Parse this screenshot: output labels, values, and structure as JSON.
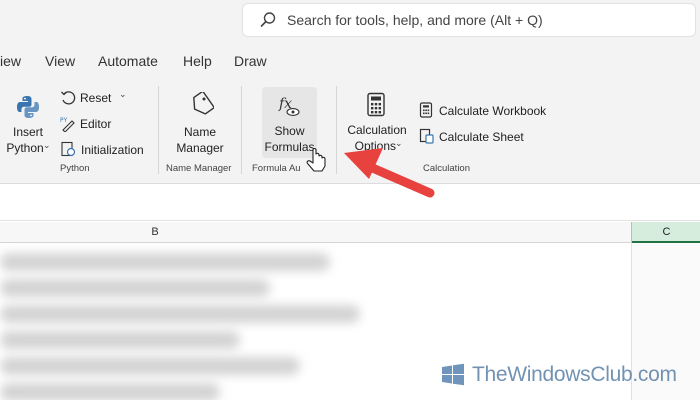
{
  "search": {
    "placeholder": "Search for tools, help, and more (Alt + Q)"
  },
  "tabs": [
    "iew",
    "View",
    "Automate",
    "Help",
    "Draw"
  ],
  "python": {
    "insert_label": "Insert",
    "python_label": "Python",
    "reset_label": "Reset",
    "editor_label": "Editor",
    "initialization_label": "Initialization",
    "group_label": "Python"
  },
  "name_manager": {
    "line1": "Name",
    "line2": "Manager",
    "group_label": "Name Manager"
  },
  "formula_auditing": {
    "line1": "Show",
    "line2": "Formulas",
    "group_label": "Formula Au"
  },
  "calculation": {
    "options_line1": "Calculation",
    "options_line2": "Options",
    "workbook_label": "Calculate Workbook",
    "sheet_label": "Calculate Sheet",
    "group_label": "Calculation"
  },
  "columns": {
    "b": "B",
    "c": "C"
  },
  "watermark": "TheWindowsClub.com",
  "colors": {
    "accent": "#217346",
    "arrow": "#e8423f",
    "python_blue": "#3a75b0"
  }
}
